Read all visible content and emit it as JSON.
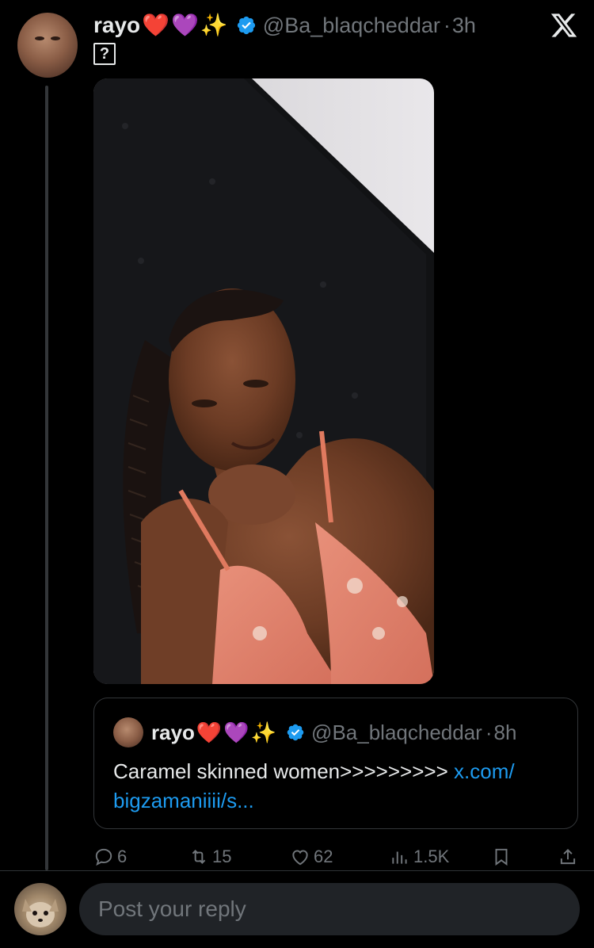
{
  "tweet": {
    "display_name": "rayo",
    "name_emojis": [
      "❤️",
      "💜",
      "✨"
    ],
    "handle": "@Ba_blaqcheddar",
    "time": "3h",
    "unknown_glyph": "?",
    "photo_alt": "Photo of a woman with braided hair posing with hand under chin"
  },
  "quoted_tweet": {
    "display_name": "rayo",
    "name_emojis": [
      "❤️",
      "💜",
      "✨"
    ],
    "handle": "@Ba_blaqcheddar",
    "time": "8h",
    "text": "Caramel skinned women>>>>>>>>> ",
    "link": "x.com/ bigzamaniiii/s..."
  },
  "actions": {
    "replies": "6",
    "reposts": "15",
    "likes": "62",
    "views": "1.5K"
  },
  "reply_bar": {
    "placeholder": "Post your reply"
  },
  "icons": {
    "app_logo": "x-logo-icon",
    "verified": "verified-badge-icon",
    "reply": "reply-icon",
    "repost": "repost-icon",
    "like": "heart-icon",
    "views": "views-icon",
    "bookmark": "bookmark-icon",
    "share": "share-icon"
  },
  "colors": {
    "background": "#000000",
    "text_primary": "#e7e9ea",
    "text_secondary": "#71767b",
    "link": "#1d9bf0",
    "verified": "#1d9bf0",
    "border": "#333639",
    "input_bg": "#202327"
  }
}
